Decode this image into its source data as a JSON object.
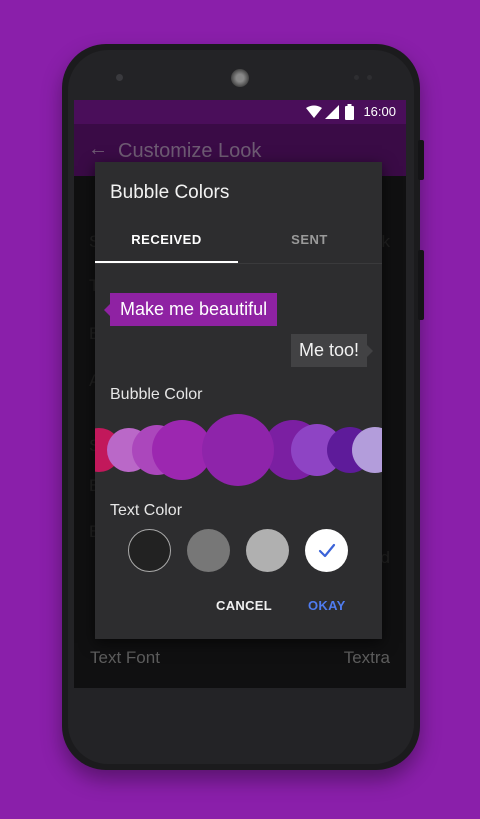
{
  "status_bar": {
    "time": "16:00"
  },
  "app_bar": {
    "title": "Customize Look"
  },
  "background": {
    "rows": [
      {
        "left": "S",
        "right": "k"
      },
      {
        "left": "T",
        "right": ""
      },
      {
        "left": "B",
        "right": ""
      },
      {
        "left": "A",
        "right": ""
      },
      {
        "left": "S",
        "right": ""
      },
      {
        "left": "B",
        "right": ""
      },
      {
        "left": "B",
        "right": "d"
      }
    ],
    "text_font_label": "Text Font",
    "text_font_value": "Textra"
  },
  "dialog": {
    "title": "Bubble Colors",
    "tabs": [
      {
        "label": "RECEIVED",
        "selected": true
      },
      {
        "label": "SENT",
        "selected": false
      }
    ],
    "preview_received": "Make me beautiful",
    "preview_sent": "Me too!",
    "bubble_color_label": "Bubble Color",
    "bubble_colors": [
      "#c2185b",
      "#ba68c8",
      "#ab47bc",
      "#9c27b0",
      "#8e24aa",
      "#7b1fa2",
      "#8e44c4",
      "#5e1b9a",
      "#b39ddb"
    ],
    "selected_bubble_color": "#8e24aa",
    "text_color_label": "Text Color",
    "text_colors": [
      "#222222",
      "#777777",
      "#b0b0b0",
      "#ffffff"
    ],
    "selected_text_color": "#ffffff",
    "cancel_label": "CANCEL",
    "okay_label": "OKAY",
    "accent_color": "#4f7cf0"
  }
}
